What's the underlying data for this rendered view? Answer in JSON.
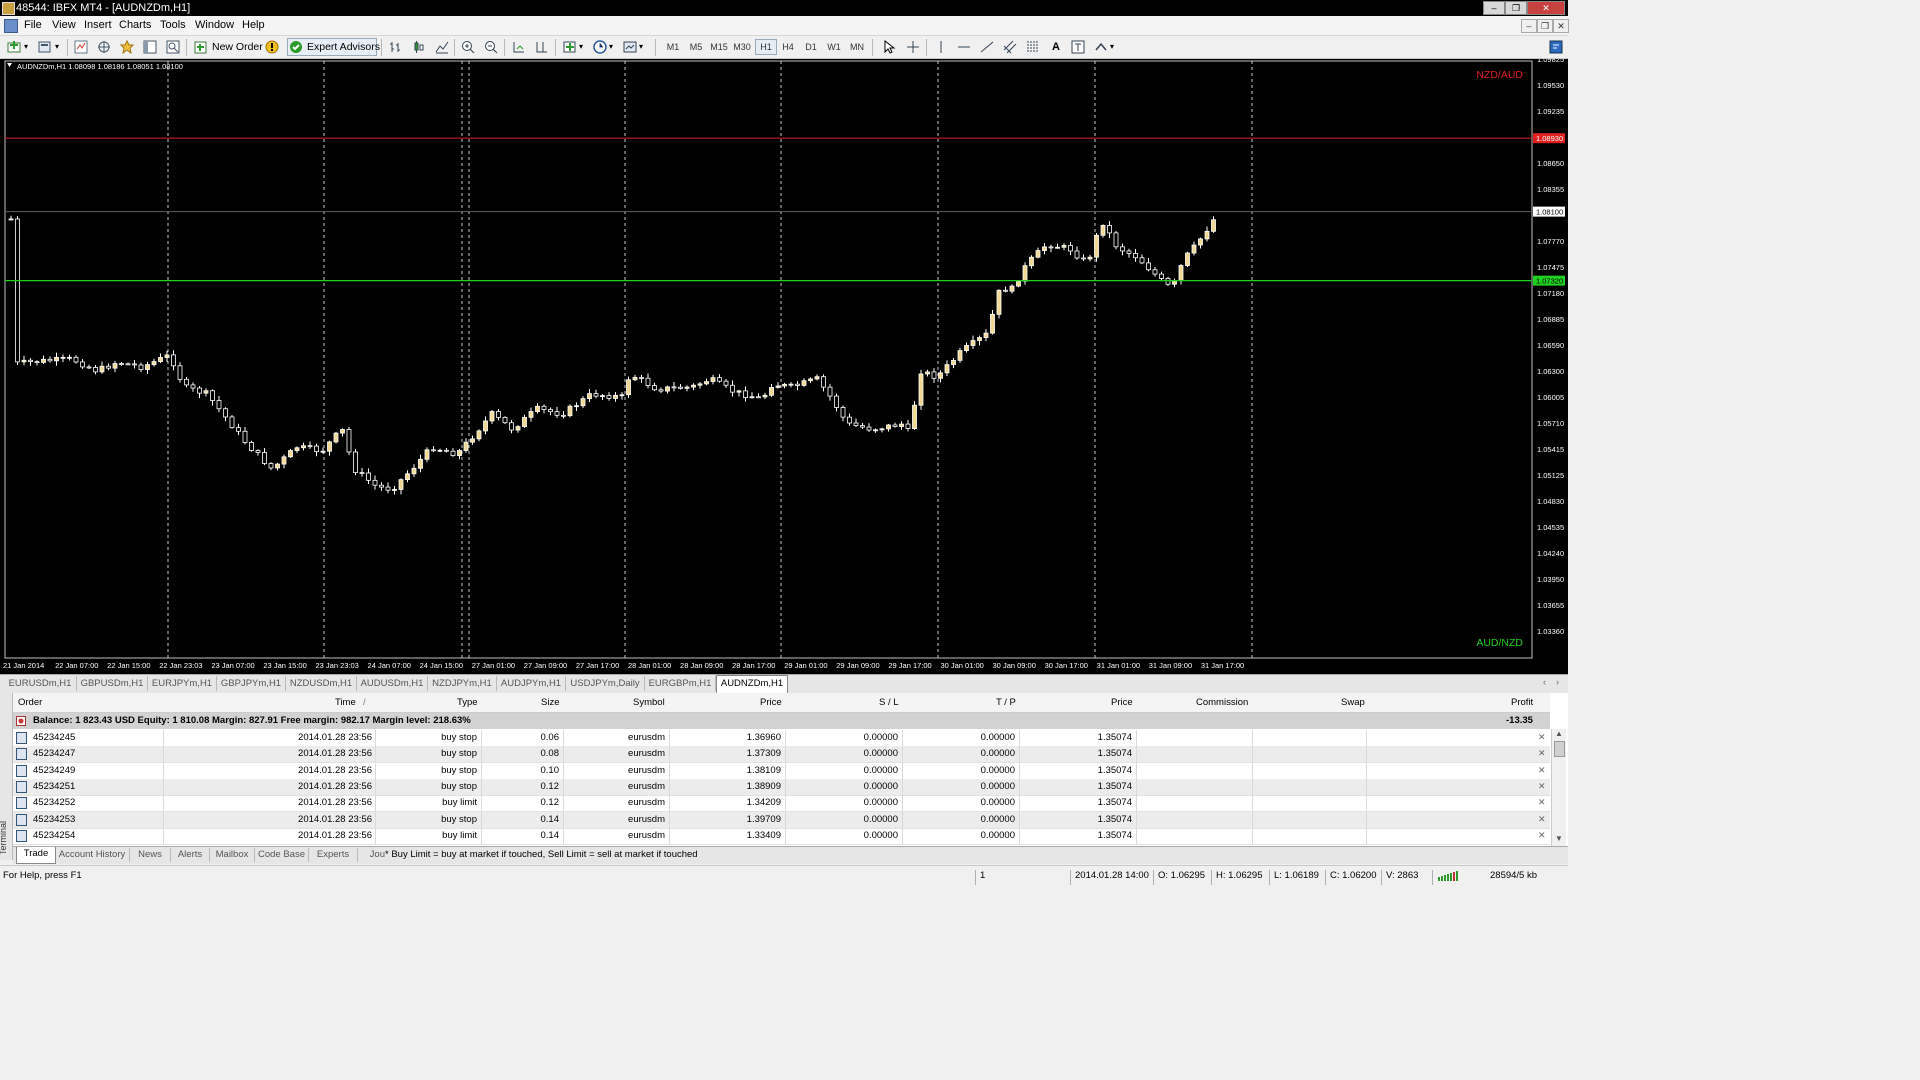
{
  "window": {
    "title": "48544: IBFX MT4 - [AUDNZDm,H1]"
  },
  "menu": [
    "File",
    "View",
    "Insert",
    "Charts",
    "Tools",
    "Window",
    "Help"
  ],
  "toolbar": {
    "new_order": "New Order",
    "expert_advisors": "Expert Advisors",
    "timeframes": [
      "M1",
      "M5",
      "M15",
      "M30",
      "H1",
      "H4",
      "D1",
      "W1",
      "MN"
    ],
    "active_timeframe": "H1"
  },
  "chart": {
    "info": "AUDNZDm,H1  1.08098 1.08186 1.08051 1.08100",
    "label_top": "NZD/AUD",
    "label_bottom": "AUD/NZD",
    "price_labels": [
      "1.09825",
      "1.09530",
      "1.09235",
      "1.08650",
      "1.08355",
      "1.07770",
      "1.07475",
      "1.07180",
      "1.06885",
      "1.06590",
      "1.06300",
      "1.06005",
      "1.05710",
      "1.05415",
      "1.05125",
      "1.04830",
      "1.04535",
      "1.04240",
      "1.03950",
      "1.03655",
      "1.03360"
    ],
    "red_line_label": "1.08930",
    "current_price_label": "1.08100",
    "green_line_label": "1.07320",
    "time_labels": [
      "21 Jan 2014",
      "22 Jan 07:00",
      "22 Jan 15:00",
      "22 Jan 23:03",
      "23 Jan 07:00",
      "23 Jan 15:00",
      "23 Jan 23:03",
      "24 Jan 07:00",
      "24 Jan 15:00",
      "27 Jan 01:00",
      "27 Jan 09:00",
      "27 Jan 17:00",
      "28 Jan 01:00",
      "28 Jan 09:00",
      "28 Jan 17:00",
      "29 Jan 01:00",
      "29 Jan 09:00",
      "29 Jan 17:00",
      "30 Jan 01:00",
      "30 Jan 09:00",
      "30 Jan 17:00",
      "31 Jan 01:00",
      "31 Jan 09:00",
      "31 Jan 17:00"
    ],
    "colors": {
      "background": "#000000",
      "bull_candle": "#f0d890",
      "bear_candle": "#000000",
      "outline": "#ffffff",
      "red_line": "#e02020",
      "green_line": "#20d020",
      "separator": "#c8c8c8"
    }
  },
  "chart_tabs": [
    "EURUSDm,H1",
    "GBPUSDm,H1",
    "EURJPYm,H1",
    "GBPJPYm,H1",
    "NZDUSDm,H1",
    "AUDUSDm,H1",
    "NZDJPYm,H1",
    "AUDJPYm,H1",
    "USDJPYm,Daily",
    "EURGBPm,H1",
    "AUDNZDm,H1"
  ],
  "active_chart_tab": "AUDNZDm,H1",
  "terminal": {
    "side_label": "Terminal",
    "headers": [
      "Order",
      "Time",
      "/",
      "Type",
      "Size",
      "Symbol",
      "Price",
      "S / L",
      "T / P",
      "Price",
      "Commission",
      "Swap",
      "Profit"
    ],
    "balance_line": "Balance: 1 823.43 USD  Equity: 1 810.08  Margin: 827.91  Free margin: 982.17  Margin level: 218.63%",
    "balance_profit": "-13.35",
    "orders": [
      {
        "order": "45234245",
        "time": "2014.01.28 23:56",
        "type": "buy stop",
        "size": "0.06",
        "symbol": "eurusdm",
        "price": "1.36960",
        "sl": "0.00000",
        "tp": "0.00000",
        "cur": "1.35074"
      },
      {
        "order": "45234247",
        "time": "2014.01.28 23:56",
        "type": "buy stop",
        "size": "0.08",
        "symbol": "eurusdm",
        "price": "1.37309",
        "sl": "0.00000",
        "tp": "0.00000",
        "cur": "1.35074"
      },
      {
        "order": "45234249",
        "time": "2014.01.28 23:56",
        "type": "buy stop",
        "size": "0.10",
        "symbol": "eurusdm",
        "price": "1.38109",
        "sl": "0.00000",
        "tp": "0.00000",
        "cur": "1.35074"
      },
      {
        "order": "45234251",
        "time": "2014.01.28 23:56",
        "type": "buy stop",
        "size": "0.12",
        "symbol": "eurusdm",
        "price": "1.38909",
        "sl": "0.00000",
        "tp": "0.00000",
        "cur": "1.35074"
      },
      {
        "order": "45234252",
        "time": "2014.01.28 23:56",
        "type": "buy limit",
        "size": "0.12",
        "symbol": "eurusdm",
        "price": "1.34209",
        "sl": "0.00000",
        "tp": "0.00000",
        "cur": "1.35074"
      },
      {
        "order": "45234253",
        "time": "2014.01.28 23:56",
        "type": "buy stop",
        "size": "0.14",
        "symbol": "eurusdm",
        "price": "1.39709",
        "sl": "0.00000",
        "tp": "0.00000",
        "cur": "1.35074"
      },
      {
        "order": "45234254",
        "time": "2014.01.28 23:56",
        "type": "buy limit",
        "size": "0.14",
        "symbol": "eurusdm",
        "price": "1.33409",
        "sl": "0.00000",
        "tp": "0.00000",
        "cur": "1.35074"
      }
    ],
    "tabs": [
      "Trade",
      "Account History",
      "News",
      "Alerts",
      "Mailbox",
      "Code Base",
      "Experts",
      "Jou"
    ],
    "active_tab": "Trade",
    "tip": "* Buy Limit = buy at market if touched, Sell Limit = sell at market if touched"
  },
  "status": {
    "help": "For Help, press F1",
    "profile": "1",
    "datetime": "2014.01.28 14:00",
    "open": "O: 1.06295",
    "high": "H: 1.06295",
    "low": "L: 1.06189",
    "close": "C: 1.06200",
    "volume": "V: 2863",
    "traffic": "28594/5 kb"
  }
}
